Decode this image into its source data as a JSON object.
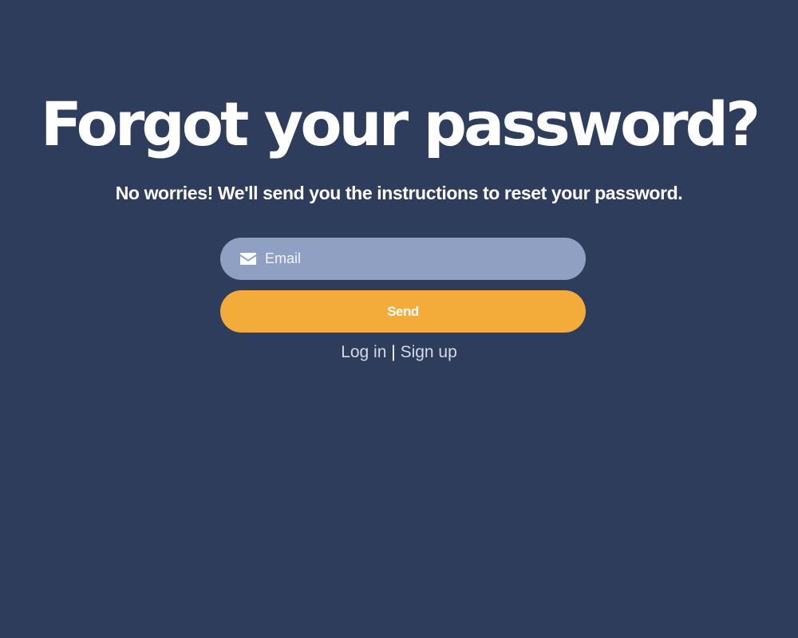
{
  "page": {
    "title": "Forgot your password?",
    "subtitle": "No worries! We'll send you the instructions to reset your password."
  },
  "form": {
    "email": {
      "icon": "envelope-icon",
      "placeholder": "Email",
      "value": ""
    },
    "send_label": "Send"
  },
  "links": {
    "login_label": "Log in",
    "separator": "|",
    "signup_label": "Sign up"
  },
  "colors": {
    "background": "#2f3d5c",
    "input_background": "#8fa0c3",
    "button_background": "#f3ac39",
    "text": "#ffffff",
    "link": "#d4d9e4"
  }
}
